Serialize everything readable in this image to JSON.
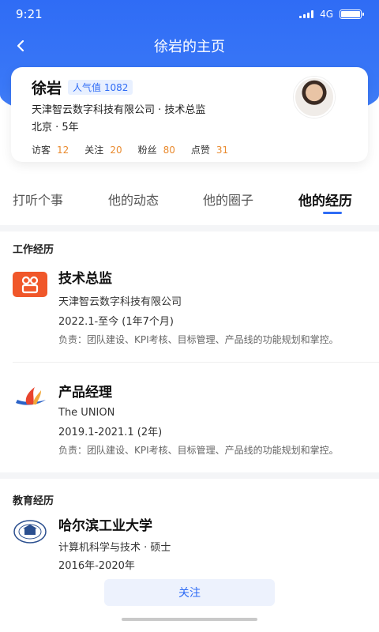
{
  "status_bar": {
    "time": "9:21",
    "network": "4G"
  },
  "nav": {
    "title": "徐岩的主页"
  },
  "profile": {
    "name": "徐岩",
    "popularity": "人气值 1082",
    "company_title": "天津智云数字科技有限公司 · 技术总监",
    "location_years": "北京 · 5年",
    "stats": [
      {
        "label": "访客",
        "value": "12"
      },
      {
        "label": "关注",
        "value": "20"
      },
      {
        "label": "粉丝",
        "value": "80"
      },
      {
        "label": "点赞",
        "value": "31"
      }
    ]
  },
  "tabs": [
    {
      "label": "打听个事"
    },
    {
      "label": "他的动态"
    },
    {
      "label": "他的圈子"
    },
    {
      "label": "他的经历"
    }
  ],
  "work": {
    "section_title": "工作经历",
    "items": [
      {
        "title": "技术总监",
        "company": "天津智云数字科技有限公司",
        "period": "2022.1-至今 (1年7个月)",
        "desc": "负责：团队建设、KPI考核、目标管理、产品线的功能规划和掌控。",
        "logo_icon": "orange-company-logo-icon"
      },
      {
        "title": "产品经理",
        "company": "The UNION",
        "period": "2019.1-2021.1 (2年)",
        "desc": "负责：团队建设、KPI考核、目标管理、产品线的功能规划和掌控。",
        "logo_icon": "flame-logo-icon"
      }
    ]
  },
  "education": {
    "section_title": "教育经历",
    "school": "哈尔滨工业大学",
    "major_degree": "计算机科学与技术 · 硕士",
    "period": "2016年-2020年"
  },
  "actions": {
    "follow": "关注"
  },
  "colors": {
    "primary": "#2f6cf5",
    "accent_number": "#e98a2e"
  }
}
